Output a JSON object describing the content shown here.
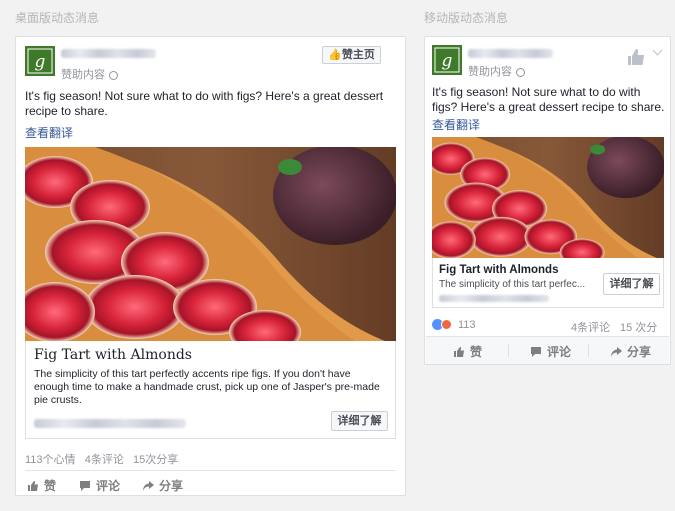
{
  "labels": {
    "desktop": "桌面版动态消息",
    "mobile": "移动版动态消息"
  },
  "post": {
    "sponsored": "赞助内容",
    "text": "It's fig season! Not sure what to do with figs? Here's a great dessert recipe to share.",
    "translate": "查看翻译",
    "like_page": "赞主页",
    "headline": "Fig Tart with Almonds",
    "description_full": "The simplicity of this tart perfectly accents ripe figs. If you don't have enough time to make a handmade crust, pick up one of Jasper's pre-made pie crusts.",
    "description_short": "The simplicity of this tart perfec...",
    "cta": "详细了解"
  },
  "desktop_stats": {
    "reactions": "113个心情",
    "comments": "4条评论",
    "shares": "15次分享"
  },
  "mobile_stats": {
    "reactions": "113",
    "comments": "4条评论",
    "shares": "15 次分享"
  },
  "actions": {
    "like": "赞",
    "comment": "评论",
    "share": "分享"
  },
  "colors": {
    "link": "#365899",
    "avatar": "#3f7a2a"
  }
}
